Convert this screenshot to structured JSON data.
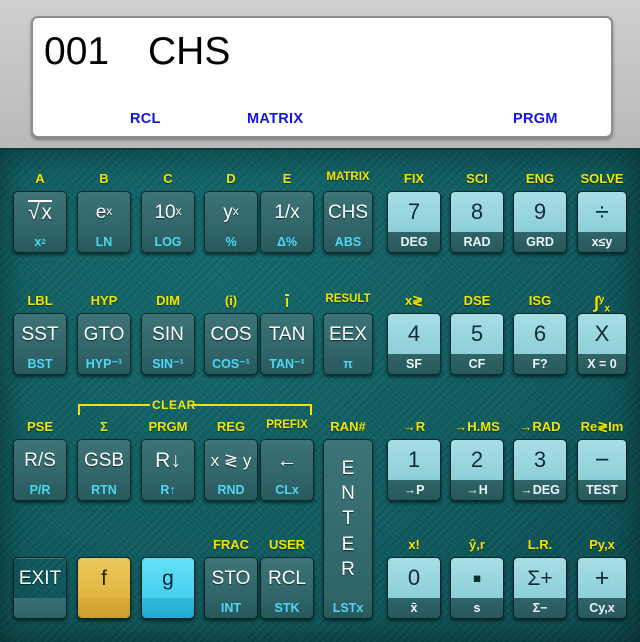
{
  "display": {
    "program_step": "001",
    "instruction": "CHS",
    "annunciators": [
      "RCL",
      "MATRIX",
      "PRGM"
    ],
    "annunciator_color": "#1414e0",
    "text_color": "#000000",
    "background": "#ffffff"
  },
  "theme": {
    "body_color": "#0e5c5f",
    "bezel_color": "#c3c3c3",
    "f_shift_color": "#f2e500",
    "g_shift_color": "#4fd6f2",
    "numeric_key_color": "#8ecfd8",
    "function_key_color": "#2f6468"
  },
  "clear_bracket": {
    "label": "CLEAR"
  },
  "keys": [
    {
      "id": "sqrt",
      "f": "A",
      "main": "√x",
      "g": "x2",
      "style": "dark",
      "col": 0,
      "row": 0
    },
    {
      "id": "exp",
      "f": "B",
      "main": "e^x",
      "g": "LN",
      "style": "dark",
      "col": 1,
      "row": 0
    },
    {
      "id": "ten-x",
      "f": "C",
      "main": "10^x",
      "g": "LOG",
      "style": "dark",
      "col": 2,
      "row": 0
    },
    {
      "id": "y-x",
      "f": "D",
      "main": "y^x",
      "g": "%",
      "style": "dark",
      "col": 3,
      "row": 0
    },
    {
      "id": "recip",
      "f": "E",
      "main": "1/x",
      "g": "Δ%",
      "style": "dark",
      "col": 4,
      "row": 0
    },
    {
      "id": "chs",
      "f": "MATRIX",
      "main": "CHS",
      "g": "ABS",
      "style": "dark",
      "col": 5,
      "row": 0
    },
    {
      "id": "seven",
      "f": "FIX",
      "main": "7",
      "g": "DEG",
      "style": "light",
      "col": 6,
      "row": 0
    },
    {
      "id": "eight",
      "f": "SCI",
      "main": "8",
      "g": "RAD",
      "style": "light",
      "col": 7,
      "row": 0
    },
    {
      "id": "nine",
      "f": "ENG",
      "main": "9",
      "g": "GRD",
      "style": "light",
      "col": 8,
      "row": 0
    },
    {
      "id": "divide",
      "f": "SOLVE",
      "main": "÷",
      "g": "x≤y",
      "style": "light",
      "col": 9,
      "row": 0
    },
    {
      "id": "sst",
      "f": "LBL",
      "main": "SST",
      "g": "BST",
      "style": "dark",
      "col": 0,
      "row": 1
    },
    {
      "id": "gto",
      "f": "HYP",
      "main": "GTO",
      "g": "HYP⁻¹",
      "style": "dark",
      "col": 1,
      "row": 1
    },
    {
      "id": "sin",
      "f": "DIM",
      "main": "SIN",
      "g": "SIN⁻¹",
      "style": "dark",
      "col": 2,
      "row": 1
    },
    {
      "id": "cos",
      "f": "(i)",
      "main": "COS",
      "g": "COS⁻¹",
      "style": "dark",
      "col": 3,
      "row": 1
    },
    {
      "id": "tan",
      "f": "I",
      "main": "TAN",
      "g": "TAN⁻¹",
      "style": "dark",
      "col": 4,
      "row": 1
    },
    {
      "id": "eex",
      "f": "RESULT",
      "main": "EEX",
      "g": "π",
      "style": "dark",
      "col": 5,
      "row": 1
    },
    {
      "id": "four",
      "f": "x≷",
      "main": "4",
      "g": "SF",
      "style": "light",
      "col": 6,
      "row": 1
    },
    {
      "id": "five",
      "f": "DSE",
      "main": "5",
      "g": "CF",
      "style": "light",
      "col": 7,
      "row": 1
    },
    {
      "id": "six",
      "f": "ISG",
      "main": "6",
      "g": "F?",
      "style": "light",
      "col": 8,
      "row": 1
    },
    {
      "id": "multiply",
      "f": "∫",
      "main": "X",
      "g": "X = 0",
      "style": "light",
      "col": 9,
      "row": 1
    },
    {
      "id": "rs",
      "f": "PSE",
      "main": "R/S",
      "g": "P/R",
      "style": "dark",
      "col": 0,
      "row": 2
    },
    {
      "id": "gsb",
      "f": "Σ",
      "main": "GSB",
      "g": "RTN",
      "style": "dark",
      "col": 1,
      "row": 2
    },
    {
      "id": "rolldn",
      "f": "PRGM",
      "main": "R↓",
      "g": "R↑",
      "style": "dark",
      "col": 2,
      "row": 2
    },
    {
      "id": "xy",
      "f": "REG",
      "main": "x ≷ y",
      "g": "RND",
      "style": "dark",
      "col": 3,
      "row": 2
    },
    {
      "id": "bksp",
      "f": "PREFIX",
      "main": "←",
      "g": "CLx",
      "style": "dark",
      "col": 4,
      "row": 2
    },
    {
      "id": "enter",
      "f": "RAN#",
      "main": "ENTER",
      "g": "LSTx",
      "style": "dark",
      "col": 5,
      "row": 2,
      "tall": true
    },
    {
      "id": "one",
      "f": "→R",
      "main": "1",
      "g": "→P",
      "style": "light",
      "col": 6,
      "row": 2
    },
    {
      "id": "two",
      "f": "→H.MS",
      "main": "2",
      "g": "→H",
      "style": "light",
      "col": 7,
      "row": 2
    },
    {
      "id": "three",
      "f": "→RAD",
      "main": "3",
      "g": "→DEG",
      "style": "light",
      "col": 8,
      "row": 2
    },
    {
      "id": "minus",
      "f": "Re≷Im",
      "main": "−",
      "g": "TEST",
      "style": "light",
      "col": 9,
      "row": 2
    },
    {
      "id": "exit",
      "f": "",
      "main": "EXIT",
      "g": "",
      "style": "nosub",
      "col": 0,
      "row": 3
    },
    {
      "id": "f-shift",
      "f": "",
      "main": "f",
      "g": "",
      "style": "gold",
      "col": 1,
      "row": 3
    },
    {
      "id": "g-shift",
      "f": "",
      "main": "g",
      "g": "",
      "style": "cyan",
      "col": 2,
      "row": 3
    },
    {
      "id": "sto",
      "f": "FRAC",
      "main": "STO",
      "g": "INT",
      "style": "dark",
      "col": 3,
      "row": 3
    },
    {
      "id": "rcl",
      "f": "USER",
      "main": "RCL",
      "g": "STK",
      "style": "dark",
      "col": 4,
      "row": 3
    },
    {
      "id": "zero",
      "f": "x!",
      "main": "0",
      "g": "x̄",
      "style": "light",
      "col": 6,
      "row": 3
    },
    {
      "id": "decimal",
      "f": "ŷ,r",
      "main": "▪",
      "g": "s",
      "style": "light",
      "col": 7,
      "row": 3
    },
    {
      "id": "sigma-plus",
      "f": "L.R.",
      "main": "Σ+",
      "g": "Σ−",
      "style": "light",
      "col": 8,
      "row": 3
    },
    {
      "id": "plus",
      "f": "Py,x",
      "main": "+",
      "g": "Cy,x",
      "style": "light",
      "col": 9,
      "row": 3
    }
  ]
}
